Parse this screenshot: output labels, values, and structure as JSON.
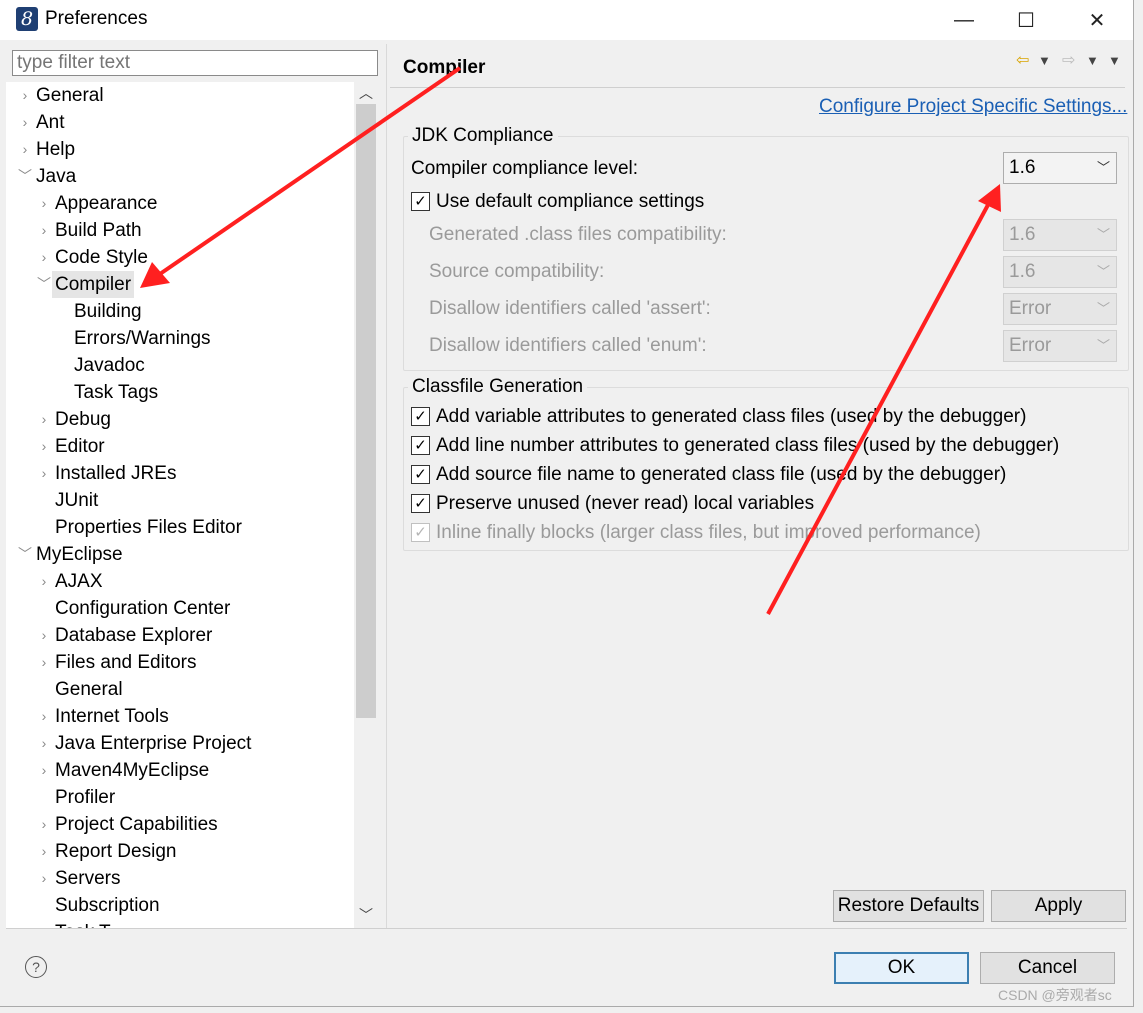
{
  "window": {
    "title": "Preferences",
    "app_icon_glyph": "8",
    "minimize_glyph": "—",
    "maximize_glyph": "☐",
    "close_glyph": "✕"
  },
  "filter": {
    "placeholder": "type filter text"
  },
  "tree": {
    "items": [
      {
        "label": "General",
        "level": 0,
        "twisty": "collapsed"
      },
      {
        "label": "Ant",
        "level": 0,
        "twisty": "collapsed"
      },
      {
        "label": "Help",
        "level": 0,
        "twisty": "collapsed"
      },
      {
        "label": "Java",
        "level": 0,
        "twisty": "expanded"
      },
      {
        "label": "Appearance",
        "level": 1,
        "twisty": "collapsed"
      },
      {
        "label": "Build Path",
        "level": 1,
        "twisty": "collapsed"
      },
      {
        "label": "Code Style",
        "level": 1,
        "twisty": "collapsed"
      },
      {
        "label": "Compiler",
        "level": 1,
        "twisty": "expanded",
        "selected": true
      },
      {
        "label": "Building",
        "level": 2,
        "twisty": "none"
      },
      {
        "label": "Errors/Warnings",
        "level": 2,
        "twisty": "none"
      },
      {
        "label": "Javadoc",
        "level": 2,
        "twisty": "none"
      },
      {
        "label": "Task Tags",
        "level": 2,
        "twisty": "none"
      },
      {
        "label": "Debug",
        "level": 1,
        "twisty": "collapsed"
      },
      {
        "label": "Editor",
        "level": 1,
        "twisty": "collapsed"
      },
      {
        "label": "Installed JREs",
        "level": 1,
        "twisty": "collapsed"
      },
      {
        "label": "JUnit",
        "level": 1,
        "twisty": "none"
      },
      {
        "label": "Properties Files Editor",
        "level": 1,
        "twisty": "none"
      },
      {
        "label": "MyEclipse",
        "level": 0,
        "twisty": "expanded"
      },
      {
        "label": "AJAX",
        "level": 1,
        "twisty": "collapsed"
      },
      {
        "label": "Configuration Center",
        "level": 1,
        "twisty": "none"
      },
      {
        "label": "Database Explorer",
        "level": 1,
        "twisty": "collapsed"
      },
      {
        "label": "Files and Editors",
        "level": 1,
        "twisty": "collapsed"
      },
      {
        "label": "General",
        "level": 1,
        "twisty": "none"
      },
      {
        "label": "Internet Tools",
        "level": 1,
        "twisty": "collapsed"
      },
      {
        "label": "Java Enterprise Project",
        "level": 1,
        "twisty": "collapsed"
      },
      {
        "label": "Maven4MyEclipse",
        "level": 1,
        "twisty": "collapsed"
      },
      {
        "label": "Profiler",
        "level": 1,
        "twisty": "none"
      },
      {
        "label": "Project Capabilities",
        "level": 1,
        "twisty": "collapsed"
      },
      {
        "label": "Report Design",
        "level": 1,
        "twisty": "collapsed"
      },
      {
        "label": "Servers",
        "level": 1,
        "twisty": "collapsed"
      },
      {
        "label": "Subscription",
        "level": 1,
        "twisty": "none"
      },
      {
        "label": "Task T...",
        "level": 1,
        "twisty": "collapsed"
      }
    ]
  },
  "page": {
    "title": "Compiler",
    "configure_link": "Configure Project Specific Settings...",
    "jdk_group": {
      "label": "JDK Compliance",
      "compliance_label": "Compiler compliance level:",
      "compliance_value": "1.6",
      "use_default_label": "Use default compliance settings",
      "use_default_checked": true,
      "generated_label": "Generated .class files compatibility:",
      "generated_value": "1.6",
      "source_label": "Source compatibility:",
      "source_value": "1.6",
      "assert_label": "Disallow identifiers called 'assert':",
      "assert_value": "Error",
      "enum_label": "Disallow identifiers called 'enum':",
      "enum_value": "Error"
    },
    "classfile_group": {
      "label": "Classfile Generation",
      "options": [
        {
          "label": "Add variable attributes to generated class files (used by the debugger)",
          "checked": true,
          "enabled": true
        },
        {
          "label": "Add line number attributes to generated class files (used by the debugger)",
          "checked": true,
          "enabled": true
        },
        {
          "label": "Add source file name to generated class file (used by the debugger)",
          "checked": true,
          "enabled": true
        },
        {
          "label": "Preserve unused (never read) local variables",
          "checked": true,
          "enabled": true
        },
        {
          "label": "Inline finally blocks (larger class files, but improved performance)",
          "checked": true,
          "enabled": false
        }
      ]
    },
    "restore_defaults": "Restore Defaults",
    "apply": "Apply"
  },
  "dialog": {
    "ok": "OK",
    "cancel": "Cancel",
    "help_glyph": "?"
  },
  "watermark": "CSDN @旁观者sc",
  "colors": {
    "annotation_arrow": "#ff2020",
    "link": "#1a5fb4",
    "default_button_border": "#3c7fb1"
  }
}
